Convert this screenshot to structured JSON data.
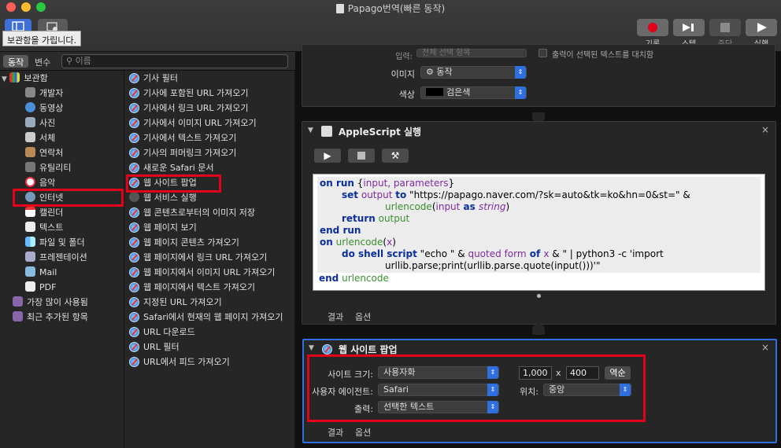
{
  "window": {
    "title": "Papago번역(빠른 동작)"
  },
  "tooltip": "보관함을 가립니다.",
  "toolbar": {
    "record": "기록",
    "step": "스텝",
    "stop": "중단",
    "run": "실행"
  },
  "library_tabs": {
    "actions": "동작",
    "variables": "변수"
  },
  "search": {
    "placeholder": "이름"
  },
  "categories": [
    {
      "label": "보관함"
    },
    {
      "label": "개발자"
    },
    {
      "label": "동영상"
    },
    {
      "label": "사진"
    },
    {
      "label": "서체"
    },
    {
      "label": "연락처"
    },
    {
      "label": "유틸리티"
    },
    {
      "label": "음악"
    },
    {
      "label": "인터넷"
    },
    {
      "label": "캘린더"
    },
    {
      "label": "텍스트"
    },
    {
      "label": "파일 및 폴더"
    },
    {
      "label": "프레젠테이션"
    },
    {
      "label": "Mail"
    },
    {
      "label": "PDF"
    },
    {
      "label": "가장 많이 사용됨"
    },
    {
      "label": "최근 추가된 항목"
    }
  ],
  "actions": [
    "기사 필터",
    "기사에 포함된 URL 가져오기",
    "기사에서 링크 URL 가져오기",
    "기사에서 이미지 URL 가져오기",
    "기사에서 텍스트 가져오기",
    "기사의 퍼머링크 가져오기",
    "새로운 Safari 문서",
    "웹 사이트 팝업",
    "웹 서비스 실행",
    "웹 콘텐츠로부터의 이미지 저장",
    "웹 페이지 보기",
    "웹 페이지 콘텐츠 가져오기",
    "웹 페이지에서 링크 URL 가져오기",
    "웹 페이지에서 이미지 URL 가져오기",
    "웹 페이지에서 텍스트 가져오기",
    "지정된 URL 가져오기",
    "Safari에서 현재의 웹 페이지 가져오기",
    "URL 다운로드",
    "URL 필터",
    "URL에서 피드 가져오기"
  ],
  "workflow_top": {
    "partial_label": "입력:",
    "partial_popup": "전체 선택 항목",
    "partial_checkbox": "출력이 선택된 텍스트를 대치함",
    "image_label": "이미지",
    "image_value": "동작",
    "color_label": "색상",
    "color_value": "검은색"
  },
  "applescript": {
    "title": "AppleScript 실행",
    "tab_results": "결과",
    "tab_options": "옵션",
    "code": {
      "l1_kw": "on run",
      "l1_a": " {",
      "l1_v": "input, parameters",
      "l1_b": "}",
      "l2_kw": "set",
      "l2_v": " output ",
      "l2_kw2": "to",
      "l2_s": " \"https://papago.naver.com/?sk=auto&tk=ko&hn=0&st=\" &",
      "l3_fn": "urlencode",
      "l3_a": "(",
      "l3_v": "input",
      "l3_kw": " as ",
      "l3_t": "string",
      "l3_b": ")",
      "l4_kw": "return",
      "l4_v": " output",
      "l5_kw": "end run",
      "l6_kw": "on",
      "l6_fn": " urlencode",
      "l6_a": "(",
      "l6_v": "x",
      "l6_b": ")",
      "l7_kw": "do shell script",
      "l7_s": " \"echo \" & ",
      "l7_q": "quoted form",
      "l7_of": " of ",
      "l7_x": "x",
      "l7_r": " & \" | python3 -c 'import",
      "l8": "urllib.parse;print(urllib.parse.quote(input()))'\"",
      "l9_kw": "end",
      "l9_fn": " urlencode"
    }
  },
  "popup_action": {
    "title": "웹 사이트 팝업",
    "site_size_label": "사이트 크기:",
    "site_size_value": "사용자화",
    "width": "1,000",
    "x": "x",
    "height": "400",
    "swap": "역순",
    "user_agent_label": "사용자 에이전트:",
    "user_agent_value": "Safari",
    "position_label": "위치:",
    "position_value": "중앙",
    "output_label": "출력:",
    "output_value": "선택한 텍스트",
    "tab_results": "결과",
    "tab_options": "옵션"
  },
  "colors": {
    "accent": "#2f6fe0",
    "highlight": "#e3001b",
    "record": "#e3001b"
  }
}
